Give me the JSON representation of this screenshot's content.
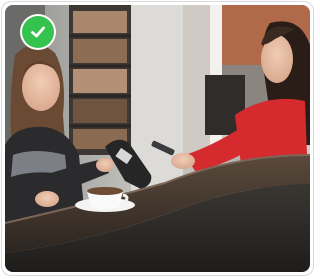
{
  "option": {
    "selected": true,
    "check_icon": "check-circle-icon",
    "accent_color": "#36c24f"
  }
}
